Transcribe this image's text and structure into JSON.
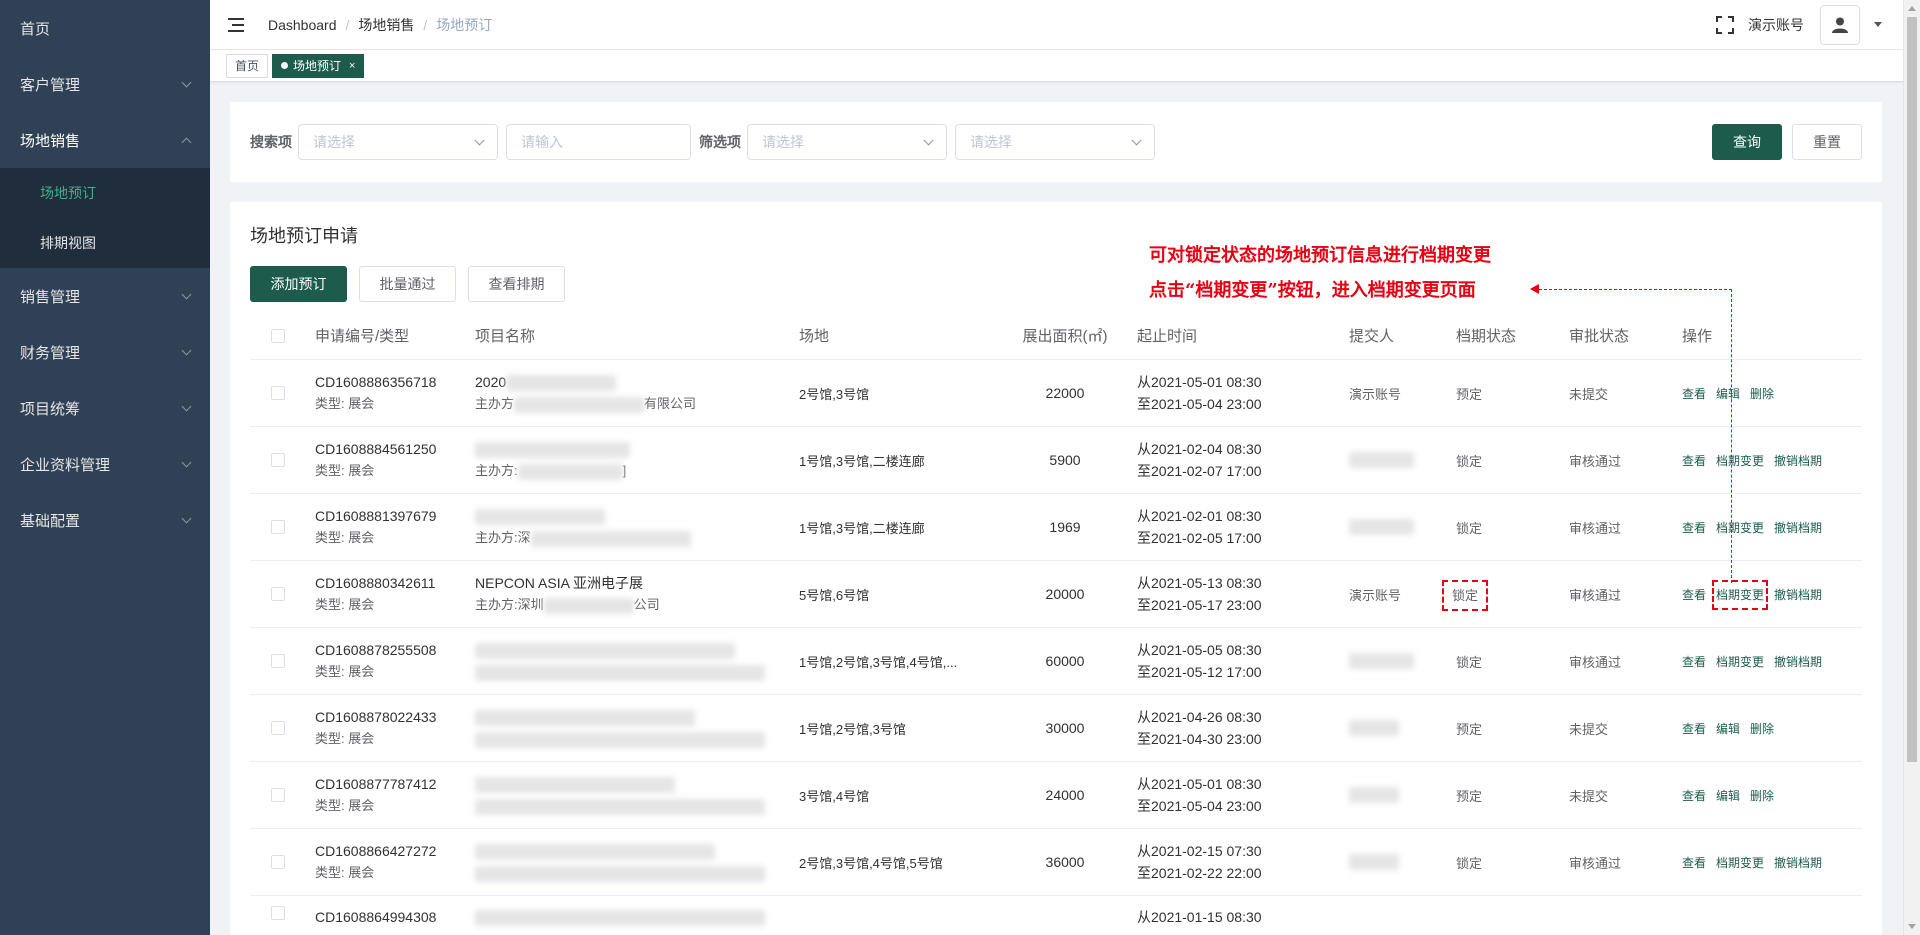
{
  "sidebar": {
    "items": [
      {
        "label": "首页",
        "has_children": false
      },
      {
        "label": "客户管理",
        "has_children": true
      },
      {
        "label": "场地销售",
        "has_children": true,
        "expanded": true,
        "children": [
          {
            "label": "场地预订",
            "active": true
          },
          {
            "label": "排期视图",
            "active": false
          }
        ]
      },
      {
        "label": "销售管理",
        "has_children": true
      },
      {
        "label": "财务管理",
        "has_children": true
      },
      {
        "label": "项目统筹",
        "has_children": true
      },
      {
        "label": "企业资料管理",
        "has_children": true
      },
      {
        "label": "基础配置",
        "has_children": true
      }
    ]
  },
  "navbar": {
    "breadcrumb": [
      "Dashboard",
      "场地销售",
      "场地预订"
    ],
    "account_name": "演示账号"
  },
  "tags": [
    {
      "label": "首页",
      "active": false
    },
    {
      "label": "场地预订",
      "active": true,
      "close": "×"
    }
  ],
  "search": {
    "label_search": "搜索项",
    "select1_placeholder": "请选择",
    "input_placeholder": "请输入",
    "label_filter": "筛选项",
    "select2_placeholder": "请选择",
    "select3_placeholder": "请选择",
    "query_label": "查询",
    "reset_label": "重置"
  },
  "card": {
    "title": "场地预订申请",
    "add_label": "添加预订",
    "batch_label": "批量通过",
    "schedule_label": "查看排期"
  },
  "table": {
    "headers": {
      "id": "申请编号/类型",
      "name": "项目名称",
      "venue": "场地",
      "area": "展出面积(㎡)",
      "time": "起止时间",
      "submitter": "提交人",
      "status": "档期状态",
      "approval": "审批状态",
      "ops": "操作"
    },
    "rows": [
      {
        "id": "CD1608886356718",
        "type": "类型: 展会",
        "name": "2020",
        "organizer": "主办方",
        "organizer_tail": "有限公司",
        "venue": "2号馆,3号馆",
        "area": "22000",
        "start": "从2021-05-01 08:30",
        "end": "至2021-05-04 23:00",
        "submitter": "演示账号",
        "status": "预定",
        "approval": "未提交",
        "ops": [
          "查看",
          "编辑",
          "删除"
        ]
      },
      {
        "id": "CD1608884561250",
        "type": "类型: 展会",
        "name": "",
        "organizer": "主办方:",
        "organizer_tail": "]",
        "venue": "1号馆,3号馆,二楼连廊",
        "area": "5900",
        "start": "从2021-02-04 08:30",
        "end": "至2021-02-07 17:00",
        "submitter": "",
        "status": "锁定",
        "approval": "审核通过",
        "ops": [
          "查看",
          "档期变更",
          "撤销档期"
        ]
      },
      {
        "id": "CD1608881397679",
        "type": "类型: 展会",
        "name": "",
        "organizer": "主办方:深",
        "organizer_tail": "",
        "venue": "1号馆,3号馆,二楼连廊",
        "area": "1969",
        "start": "从2021-02-01 08:30",
        "end": "至2021-02-05 17:00",
        "submitter": "",
        "status": "锁定",
        "approval": "审核通过",
        "ops": [
          "查看",
          "档期变更",
          "撤销档期"
        ]
      },
      {
        "id": "CD1608880342611",
        "type": "类型: 展会",
        "name": "NEPCON ASIA 亚洲电子展",
        "organizer": "主办方:深圳",
        "organizer_tail": "公司",
        "venue": "5号馆,6号馆",
        "area": "20000",
        "start": "从2021-05-13 08:30",
        "end": "至2021-05-17 23:00",
        "submitter": "演示账号",
        "status": "锁定",
        "approval": "审核通过",
        "ops": [
          "查看",
          "档期变更",
          "撤销档期"
        ],
        "highlight": true
      },
      {
        "id": "CD1608878255508",
        "type": "类型: 展会",
        "name": "",
        "organizer": "",
        "organizer_tail": "",
        "venue": "1号馆,2号馆,3号馆,4号馆,...",
        "area": "60000",
        "start": "从2021-05-05 08:30",
        "end": "至2021-05-12 17:00",
        "submitter": "",
        "status": "锁定",
        "approval": "审核通过",
        "ops": [
          "查看",
          "档期变更",
          "撤销档期"
        ]
      },
      {
        "id": "CD1608878022433",
        "type": "类型: 展会",
        "name": "",
        "organizer": "",
        "organizer_tail": "",
        "venue": "1号馆,2号馆,3号馆",
        "area": "30000",
        "start": "从2021-04-26 08:30",
        "end": "至2021-04-30 23:00",
        "submitter": "",
        "status": "预定",
        "approval": "未提交",
        "ops": [
          "查看",
          "编辑",
          "删除"
        ]
      },
      {
        "id": "CD1608877787412",
        "type": "类型: 展会",
        "name": "",
        "organizer": "",
        "organizer_tail": "",
        "venue": "3号馆,4号馆",
        "area": "24000",
        "start": "从2021-05-01 08:30",
        "end": "至2021-05-04 23:00",
        "submitter": "",
        "status": "预定",
        "approval": "未提交",
        "ops": [
          "查看",
          "编辑",
          "删除"
        ]
      },
      {
        "id": "CD1608866427272",
        "type": "类型: 展会",
        "name": "",
        "organizer": "",
        "organizer_tail": "",
        "venue": "2号馆,3号馆,4号馆,5号馆",
        "area": "36000",
        "start": "从2021-02-15 07:30",
        "end": "至2021-02-22 22:00",
        "submitter": "",
        "status": "锁定",
        "approval": "审核通过",
        "ops": [
          "查看",
          "档期变更",
          "撤销档期"
        ]
      },
      {
        "id": "CD1608864994308",
        "type": "",
        "name": "",
        "organizer": "",
        "organizer_tail": "",
        "venue": "",
        "area": "",
        "start": "从2021-01-15 08:30",
        "end": "",
        "submitter": "",
        "status": "",
        "approval": "",
        "ops": []
      }
    ]
  },
  "annotation": {
    "line1": "可对锁定状态的场地预订信息进行档期变更",
    "line2": "点击“档期变更”按钮，进入档期变更页面"
  },
  "colors": {
    "sidebar_bg": "#304156",
    "submenu_bg": "#1f2d3d",
    "primary": "#1d5c4c",
    "active_menu_text": "#41b08f",
    "annotation_red": "#e60012"
  }
}
